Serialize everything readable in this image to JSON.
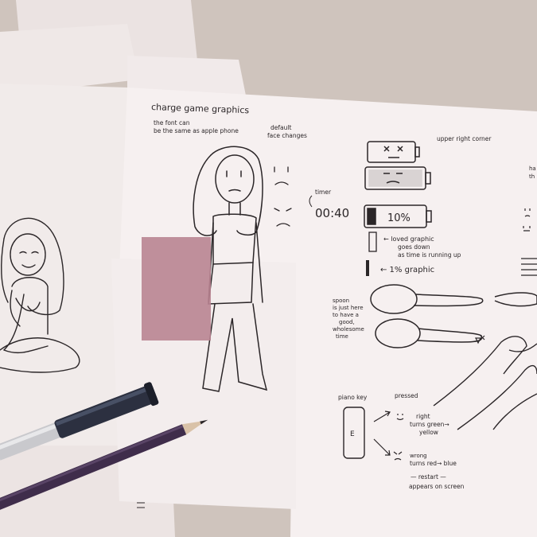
{
  "colors": {
    "table": "#cfc4bd",
    "paper": "#f4eeee",
    "paper_shade": "#ebe3e2",
    "ink": "#2b2628",
    "sticky_note": "#b98491",
    "pen_body": "#2c3040",
    "pen_tip": "#c9c9cd",
    "pencil": "#3f2d4b"
  },
  "sketch": {
    "title": "charge game graphics",
    "font_note": [
      "the font can",
      "be the same as apple phone"
    ],
    "face_note": [
      "default",
      "face changes"
    ],
    "timer_label": "timer",
    "timer_value": "00:40",
    "corner_note": "upper right corner",
    "battery_percent": "10%",
    "graphic_note": [
      "← loved graphic",
      "goes down",
      "as time is running up"
    ],
    "one_percent_note": "← 1% graphic",
    "spoon_note": [
      "spoon",
      "is just here",
      "to have a",
      "good,",
      "wholesome",
      "time"
    ],
    "piano_label": "piano key",
    "piano_key_letter": "E",
    "pressed_label": "pressed",
    "right_note": [
      "right",
      "turns green→",
      "yellow"
    ],
    "wrong_note": [
      "wrong",
      "turns red→ blue"
    ],
    "restart_note": [
      "— restart —",
      "appears on screen"
    ],
    "edge_marks": [
      "ha",
      "th"
    ]
  }
}
